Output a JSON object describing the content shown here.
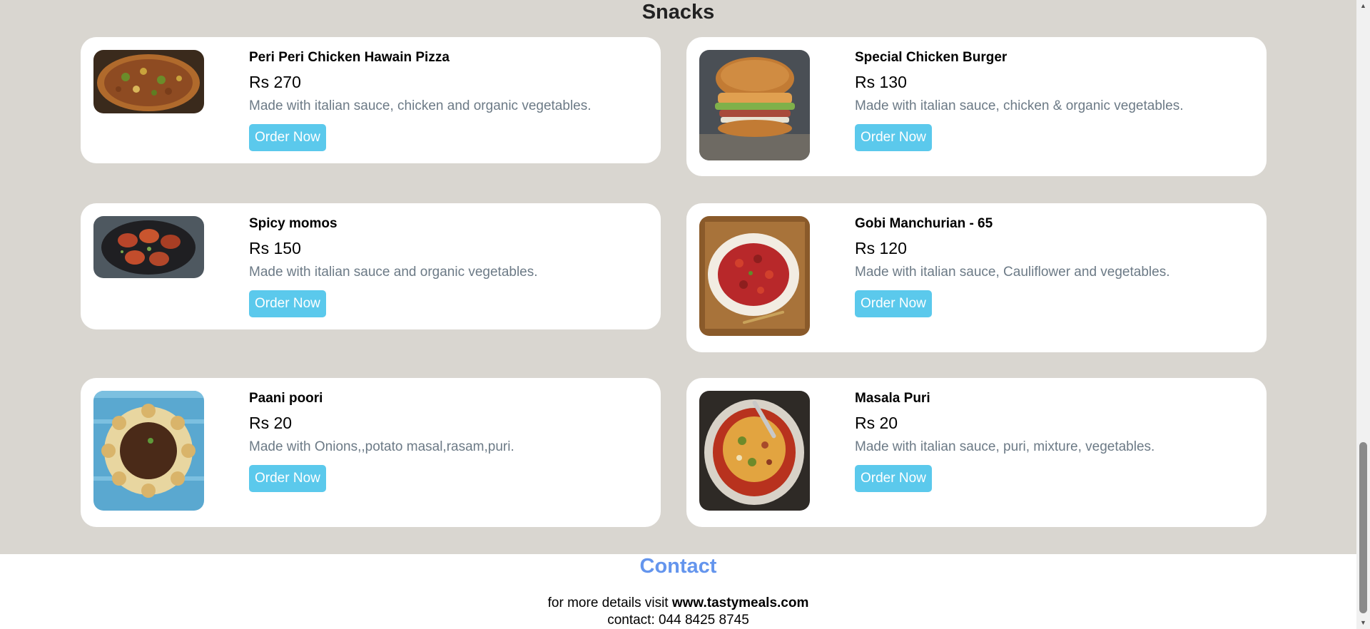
{
  "section": {
    "title": "Snacks"
  },
  "items": [
    {
      "name": "Peri Peri Chicken Hawain Pizza",
      "price": "Rs 270",
      "description": "Made with italian sauce, chicken and organic vegetables.",
      "button_label": "Order Now",
      "image_icon": "pizza-image"
    },
    {
      "name": "Special Chicken Burger",
      "price": "Rs 130",
      "description": "Made with italian sauce, chicken & organic vegetables.",
      "button_label": "Order Now",
      "image_icon": "burger-image"
    },
    {
      "name": "Spicy momos",
      "price": "Rs 150",
      "description": "Made with italian sauce and organic vegetables.",
      "button_label": "Order Now",
      "image_icon": "momos-image"
    },
    {
      "name": "Gobi Manchurian - 65",
      "price": "Rs 120",
      "description": "Made with italian sauce, Cauliflower and vegetables.",
      "button_label": "Order Now",
      "image_icon": "gobi-manchurian-image"
    },
    {
      "name": "Paani poori",
      "price": "Rs 20",
      "description": "Made with Onions,,potato masal,rasam,puri.",
      "button_label": "Order Now",
      "image_icon": "paani-poori-image"
    },
    {
      "name": "Masala Puri",
      "price": "Rs 20",
      "description": "Made with italian sauce, puri, mixture, vegetables.",
      "button_label": "Order Now",
      "image_icon": "masala-puri-image"
    }
  ],
  "contact": {
    "title": "Contact",
    "details_prefix": "for more details visit ",
    "website": "www.tastymeals.com",
    "phone_line": "contact: 044 8425 8745"
  },
  "colors": {
    "section_background": "#d9d6d0",
    "button": "#5bc9ec",
    "description_text": "#6c7a86",
    "contact_title": "#6495ed"
  }
}
